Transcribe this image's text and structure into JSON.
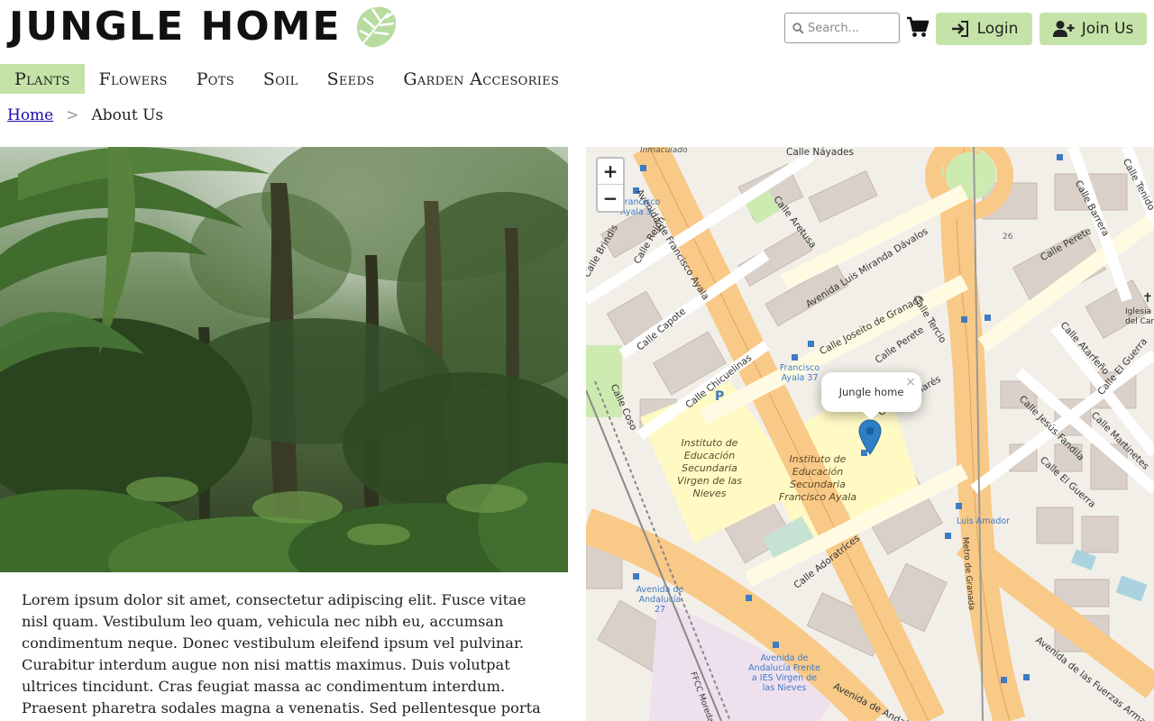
{
  "header": {
    "brand": "JUNGLE HOME",
    "search_placeholder": "Search...",
    "login_label": "Login",
    "join_label": "Join Us"
  },
  "nav": {
    "items": [
      "Plants",
      "Flowers",
      "Pots",
      "Soil",
      "Seeds",
      "Garden Accesories"
    ],
    "active": "Plants"
  },
  "breadcrumb": {
    "home": "Home",
    "separator": ">",
    "current": "About Us"
  },
  "about": {
    "text": "Lorem ipsum dolor sit amet, consectetur adipiscing elit. Fusce vitae nisl quam. Vestibulum leo quam, vehicula nec nibh eu, accumsan condimentum neque. Donec vestibulum eleifend ipsum vel pulvinar. Curabitur interdum augue non nisi mattis maximus. Duis volutpat ultrices tincidunt. Cras feugiat massa ac condimentum interdum. Praesent pharetra sodales magna a venenatis. Sed pellentesque porta"
  },
  "map": {
    "zoom_in": "+",
    "zoom_out": "−",
    "popup_text": "Jungle home",
    "popup_close": "×",
    "streets": [
      "Calle Náyades",
      "Avenida de Francisco Ayala",
      "Calle Aretusa",
      "Avenida Luis Miranda Dávalos",
      "Calle Perete",
      "Calle Barrera",
      "Calle Tenido",
      "Calle Rejón",
      "Calle Brindis",
      "Calle Capote",
      "Calle Joseito de Granada",
      "Calle Tercio",
      "Calle Perete",
      "Calle Chicuelinas",
      "Calle Coso",
      "Calle Atarfeño",
      "Calle El Guerra",
      "Calle Jesús Fandila",
      "Calle Martinetes",
      "Calle El Guerra",
      "Calle Adoratrices",
      "Calle Cucharés",
      "Avenida de Andalucía",
      "Avenida de las Fuerzas Armadas",
      "Metro de Granada",
      "FFCC Moreda"
    ],
    "stops": [
      "Francisco Ayala 3",
      "Francisco Ayala 37",
      "Luis Amador",
      "Avenida de Andalucía 27",
      "Avenida de Andalucía Frente a IES Virgen de las Nieves"
    ],
    "places": [
      "Instituto de Educación Secundaria Virgen de las Nieves",
      "Instituto de Educación Secundaria Francisco Ayala",
      "Inmaculado",
      "Iglesia del Car",
      "26"
    ]
  }
}
